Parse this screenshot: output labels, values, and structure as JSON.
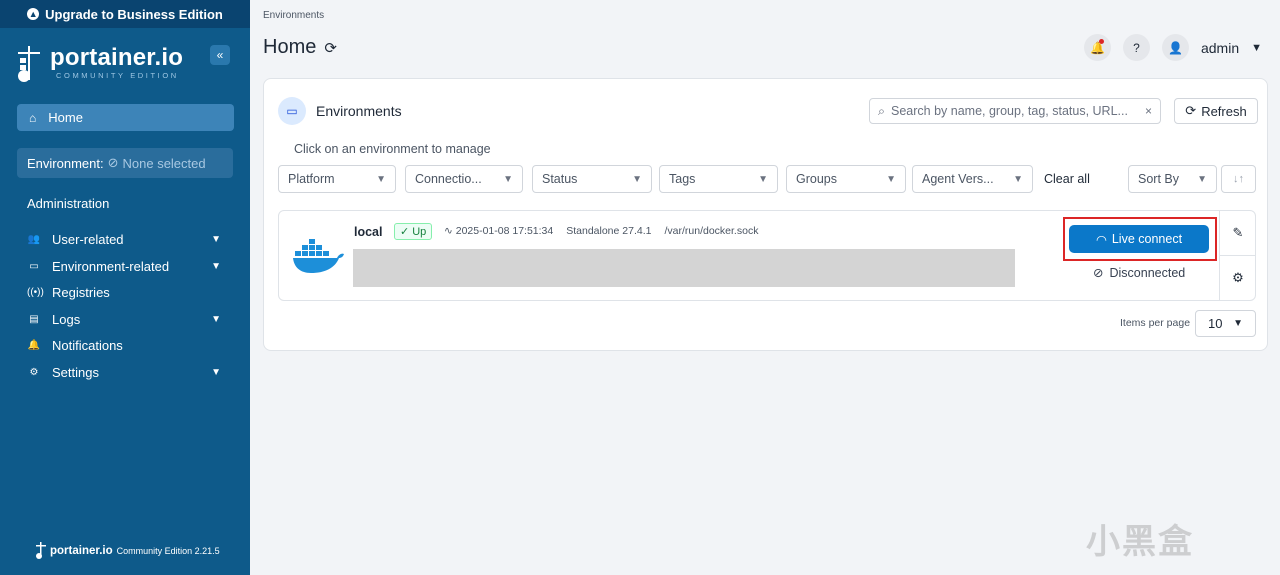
{
  "sidebar": {
    "upgrade_label": "Upgrade to Business Edition",
    "brand": "portainer.io",
    "edition": "COMMUNITY EDITION",
    "collapse_glyph": "«",
    "home_label": "Home",
    "environment_label": "Environment:",
    "environment_value": "None selected",
    "section_admin": "Administration",
    "items": [
      {
        "label": "User-related",
        "icon": "users-icon",
        "expandable": true
      },
      {
        "label": "Environment-related",
        "icon": "hdd-icon",
        "expandable": true
      },
      {
        "label": "Registries",
        "icon": "radio-icon",
        "expandable": false
      },
      {
        "label": "Logs",
        "icon": "file-icon",
        "expandable": true
      },
      {
        "label": "Notifications",
        "icon": "bell-icon",
        "expandable": false
      },
      {
        "label": "Settings",
        "icon": "gear-icon",
        "expandable": true
      }
    ],
    "footer_brand": "portainer.io",
    "footer_edition": "Community Edition 2.21.5"
  },
  "header": {
    "breadcrumb": "Environments",
    "title": "Home",
    "user": "admin"
  },
  "environments": {
    "title": "Environments",
    "search_placeholder": "Search by name, group, tag, status, URL...",
    "refresh_label": "Refresh",
    "hint": "Click on an environment to manage",
    "filters": [
      "Platform",
      "Connectio...",
      "Status",
      "Tags",
      "Groups",
      "Agent Vers..."
    ],
    "clear_all": "Clear all",
    "sort_by": "Sort By",
    "sort_dir_glyph": "↓↑",
    "items": [
      {
        "name": "local",
        "status": "Up",
        "timestamp": "2025-01-08 17:51:34",
        "type": "Standalone 27.4.1",
        "url": "/var/run/docker.sock",
        "live_connect": "Live connect",
        "connection": "Disconnected"
      }
    ],
    "items_per_page_label": "Items per page",
    "items_per_page": "10"
  },
  "watermark": "小黑盒",
  "colors": {
    "sidebar": "#0e5a8a",
    "primary": "#0b78c9",
    "highlight": "#dc2626",
    "status_up": "#15803d"
  }
}
